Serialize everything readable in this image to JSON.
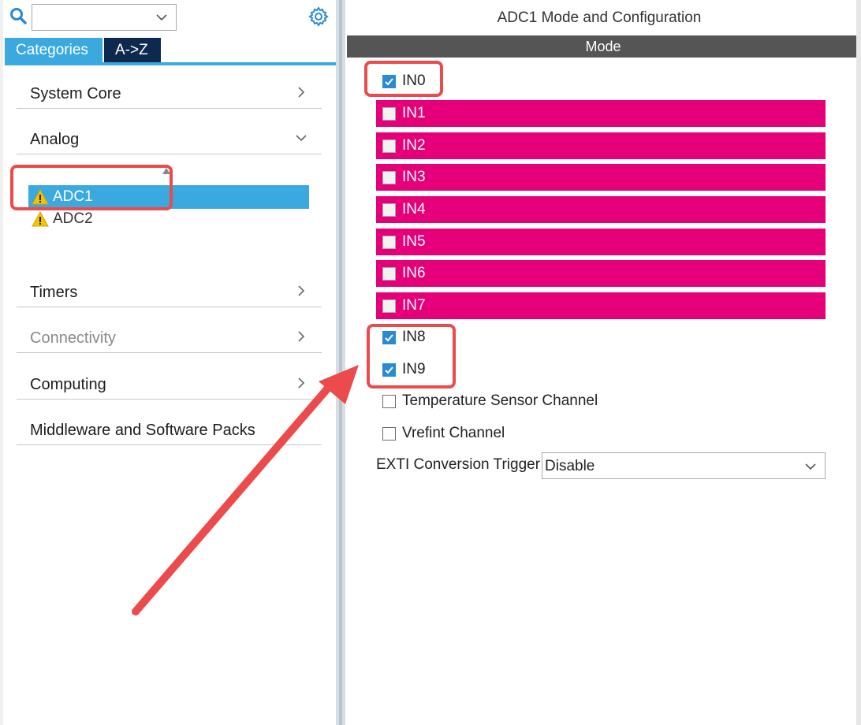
{
  "sidebar": {
    "search": {
      "value": "",
      "placeholder": ""
    },
    "tabs": [
      {
        "label": "Categories",
        "active": true
      },
      {
        "label": "A->Z",
        "active": false
      }
    ],
    "categories": {
      "system_core": "System Core",
      "analog": "Analog",
      "timers": "Timers",
      "connectivity": "Connectivity",
      "computing": "Computing",
      "middleware": "Middleware and Software Packs"
    },
    "analog_items": [
      {
        "label": "ADC1",
        "selected": true,
        "icon": "warning-icon"
      },
      {
        "label": "ADC2",
        "selected": false,
        "icon": "warning-icon"
      }
    ]
  },
  "main": {
    "title": "ADC1 Mode and Configuration",
    "section": "Mode",
    "channels": [
      {
        "label": "IN0",
        "checked": true
      },
      {
        "label": "IN1",
        "checked": false
      },
      {
        "label": "IN2",
        "checked": false
      },
      {
        "label": "IN3",
        "checked": false
      },
      {
        "label": "IN4",
        "checked": false
      },
      {
        "label": "IN5",
        "checked": false
      },
      {
        "label": "IN6",
        "checked": false
      },
      {
        "label": "IN7",
        "checked": false
      },
      {
        "label": "IN8",
        "checked": true
      },
      {
        "label": "IN9",
        "checked": true
      },
      {
        "label": "Temperature Sensor Channel",
        "checked": false
      },
      {
        "label": "Vrefint Channel",
        "checked": false
      }
    ],
    "exti": {
      "label": "EXTI Conversion Trigger",
      "value": "Disable"
    }
  },
  "colors": {
    "accent": "#3aa9df",
    "tab_inactive": "#0d2a4e",
    "conflict_pink": "#e5007a",
    "checkbox_checked": "#2a8ad4",
    "annotation_red": "#ec4b4b",
    "mode_bar": "#555555"
  }
}
